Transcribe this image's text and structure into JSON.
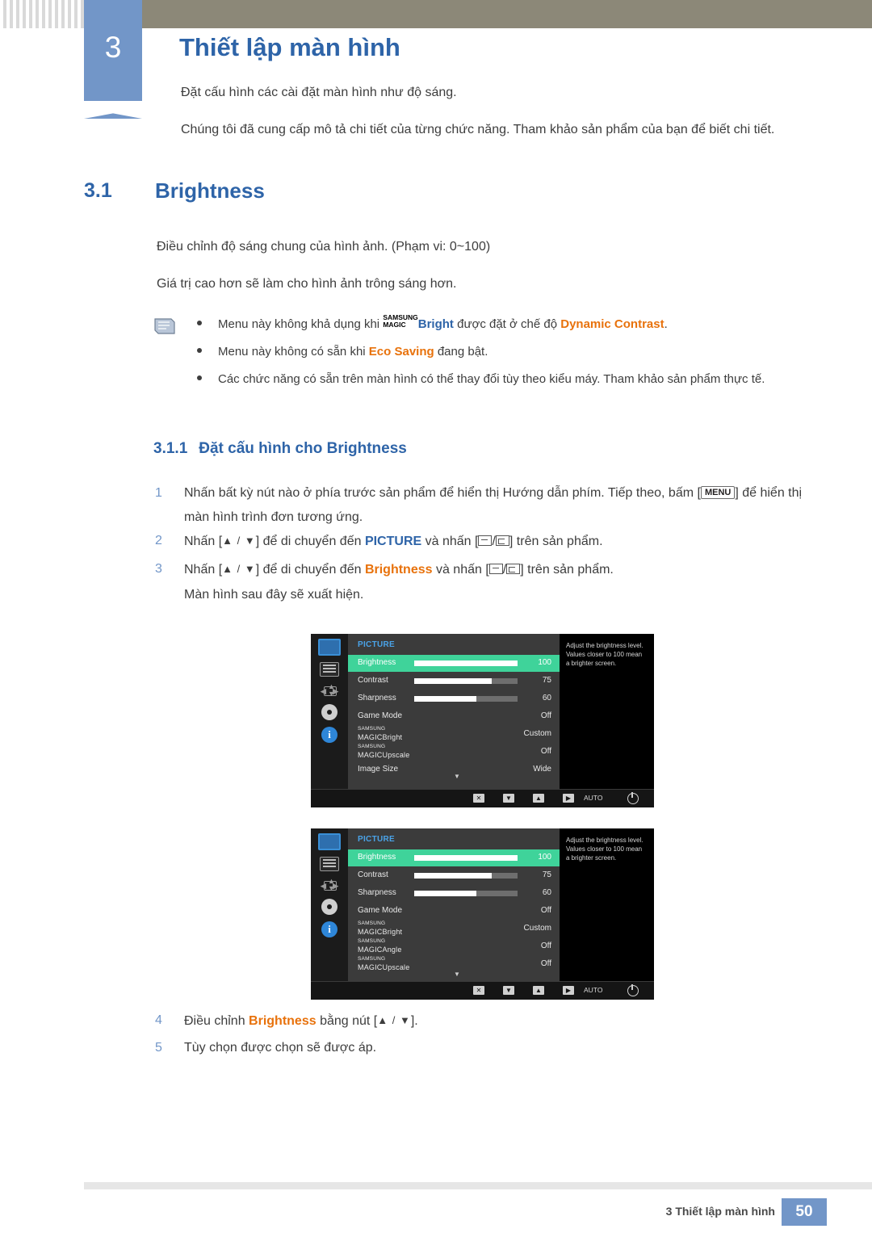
{
  "header": {
    "chapter_number": "3",
    "title": "Thiết lập màn hình",
    "sub1": "Đặt cấu hình các cài đặt màn hình như độ sáng.",
    "sub2": "Chúng tôi đã cung cấp mô tả chi tiết của từng chức năng. Tham khảo sản phẩm của bạn để biết chi tiết."
  },
  "section": {
    "number": "3.1",
    "title": "Brightness",
    "para1": "Điều chỉnh độ sáng chung của hình ảnh. (Phạm vi: 0~100)",
    "para2": "Giá trị cao hơn sẽ làm cho hình ảnh trông sáng hơn."
  },
  "notes": {
    "item1_a": "Menu này không khả dụng khi ",
    "item1_magic_top": "SAMSUNG",
    "item1_magic_bottom": "MAGIC",
    "item1_b": "Bright",
    "item1_c": " được đặt ở chế độ ",
    "item1_d": "Dynamic Contrast",
    "item1_e": ".",
    "item2_a": "Menu này không có sẵn khi ",
    "item2_b": "Eco Saving",
    "item2_c": " đang bật.",
    "item3": "Các chức năng có sẵn trên màn hình có thể thay đổi tùy theo kiểu máy. Tham khảo sản phẩm thực tế."
  },
  "subsection": {
    "number": "3.1.1",
    "title": "Đặt cấu hình cho Brightness"
  },
  "steps": {
    "s1_num": "1",
    "s1_a": "Nhấn bất kỳ nút nào ở phía trước sản phẩm để hiển thị Hướng dẫn phím. Tiếp theo, bấm [",
    "s1_key": "MENU",
    "s1_b": "] để hiển thị màn hình trình đơn tương ứng.",
    "s2_num": "2",
    "s2_a": "Nhấn [",
    "s2_keys": "▲ / ▼",
    "s2_b": "] để di chuyển đến ",
    "s2_target": "PICTURE",
    "s2_c": " và nhấn [",
    "s2_d": "] trên sản phẩm.",
    "s3_num": "3",
    "s3_a": "Nhấn [",
    "s3_keys": "▲ / ▼",
    "s3_b": "] để di chuyển đến ",
    "s3_target": "Brightness",
    "s3_c": " và nhấn [",
    "s3_d": "] trên sản phẩm.",
    "s3_extra": "Màn hình sau đây sẽ xuất hiện.",
    "s4_num": "4",
    "s4_a": "Điều chỉnh ",
    "s4_target": "Brightness",
    "s4_b": " bằng nút [",
    "s4_keys": "▲ / ▼",
    "s4_c": "].",
    "s5_num": "5",
    "s5_text": "Tùy chọn được chọn sẽ được áp."
  },
  "osd": {
    "menu_title": "PICTURE",
    "help_text": "Adjust the brightness level. Values closer to 100 mean a brighter screen.",
    "magic_top": "SAMSUNG",
    "magic_bottom": "MAGIC",
    "bottom_bar": {
      "exit": "✕",
      "down": "▼",
      "up": "▲",
      "enter": "▶",
      "auto": "AUTO"
    },
    "screen1_rows": [
      {
        "label": "Brightness",
        "value": "100",
        "bar": 100,
        "highlight": true
      },
      {
        "label": "Contrast",
        "value": "75",
        "bar": 75,
        "highlight": false
      },
      {
        "label": "Sharpness",
        "value": "60",
        "bar": 60,
        "highlight": false
      },
      {
        "label": "Game Mode",
        "value": "Off",
        "bar": null,
        "highlight": false
      },
      {
        "label": "MAGICBright",
        "value": "Custom",
        "bar": null,
        "highlight": false,
        "magic": true
      },
      {
        "label": "MAGICUpscale",
        "value": "Off",
        "bar": null,
        "highlight": false,
        "magic": true
      },
      {
        "label": "Image Size",
        "value": "Wide",
        "bar": null,
        "highlight": false
      }
    ],
    "screen2_rows": [
      {
        "label": "Brightness",
        "value": "100",
        "bar": 100,
        "highlight": true
      },
      {
        "label": "Contrast",
        "value": "75",
        "bar": 75,
        "highlight": false
      },
      {
        "label": "Sharpness",
        "value": "60",
        "bar": 60,
        "highlight": false
      },
      {
        "label": "Game Mode",
        "value": "Off",
        "bar": null,
        "highlight": false
      },
      {
        "label": "MAGICBright",
        "value": "Custom",
        "bar": null,
        "highlight": false,
        "magic": true
      },
      {
        "label": "MAGICAngle",
        "value": "Off",
        "bar": null,
        "highlight": false,
        "magic": true
      },
      {
        "label": "MAGICUpscale",
        "value": "Off",
        "bar": null,
        "highlight": false,
        "magic": true
      }
    ]
  },
  "footer": {
    "text": "3 Thiết lập màn hình",
    "page": "50"
  }
}
